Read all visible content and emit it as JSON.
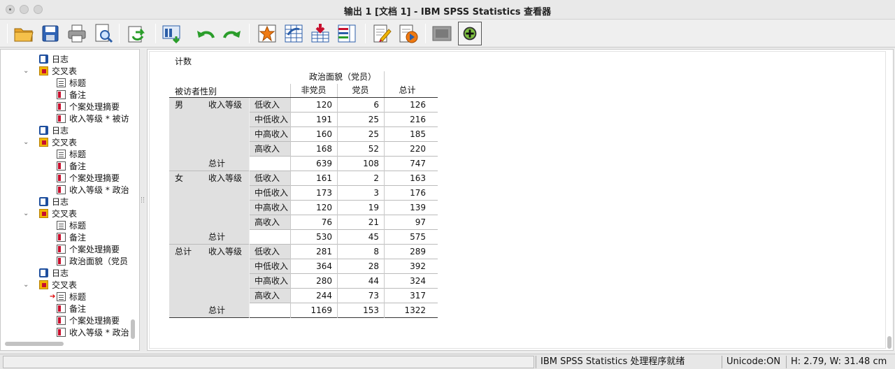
{
  "window": {
    "title": "输出 1 [文档 1] - IBM SPSS Statistics 查看器"
  },
  "toolbar": {
    "buttons": [
      "open-icon",
      "save-icon",
      "print-icon",
      "print-preview-icon",
      "export-icon",
      "recall-dialog-icon",
      "undo-icon",
      "redo-icon",
      "goto-data-icon",
      "goto-case-icon",
      "goto-variable-icon",
      "variables-icon",
      "designate-window-icon",
      "insert-output-icon",
      "hide-output-icon",
      "show-output-icon"
    ]
  },
  "nav": {
    "items": [
      {
        "label": "日志",
        "icon": "log-icon",
        "level": 1
      },
      {
        "label": "交叉表",
        "icon": "crosstab-icon",
        "level": 1
      },
      {
        "label": "标题",
        "icon": "title-icon",
        "level": 2
      },
      {
        "label": "备注",
        "icon": "notes-icon",
        "level": 2
      },
      {
        "label": "个案处理摘要",
        "icon": "table-icon",
        "level": 2
      },
      {
        "label": "收入等级 * 被访",
        "icon": "table-icon",
        "level": 2
      },
      {
        "label": "日志",
        "icon": "log-icon",
        "level": 1
      },
      {
        "label": "交叉表",
        "icon": "crosstab-icon",
        "level": 1
      },
      {
        "label": "标题",
        "icon": "title-icon",
        "level": 2
      },
      {
        "label": "备注",
        "icon": "notes-icon",
        "level": 2
      },
      {
        "label": "个案处理摘要",
        "icon": "table-icon",
        "level": 2
      },
      {
        "label": "收入等级 * 政治",
        "icon": "table-icon",
        "level": 2
      },
      {
        "label": "日志",
        "icon": "log-icon",
        "level": 1
      },
      {
        "label": "交叉表",
        "icon": "crosstab-icon",
        "level": 1
      },
      {
        "label": "标题",
        "icon": "title-icon",
        "level": 2
      },
      {
        "label": "备注",
        "icon": "notes-icon",
        "level": 2
      },
      {
        "label": "个案处理摘要",
        "icon": "table-icon",
        "level": 2
      },
      {
        "label": "政治面貌（党员",
        "icon": "table-icon",
        "level": 2
      },
      {
        "label": "日志",
        "icon": "log-icon",
        "level": 1
      },
      {
        "label": "交叉表",
        "icon": "crosstab-icon",
        "level": 1
      },
      {
        "label": "标题",
        "icon": "title-icon",
        "level": 2,
        "current": true
      },
      {
        "label": "备注",
        "icon": "notes-icon",
        "level": 2
      },
      {
        "label": "个案处理摘要",
        "icon": "table-icon",
        "level": 2
      },
      {
        "label": "收入等级 * 政治",
        "icon": "table-icon",
        "level": 2
      }
    ]
  },
  "pivot": {
    "caption": "计数",
    "col_group": "政治面貌（党员）",
    "row_var": "被访者性别",
    "col_headers": [
      "非党员",
      "党员",
      "总计"
    ],
    "groups": [
      {
        "label": "男",
        "var": "收入等级",
        "rows": [
          {
            "label": "低收入",
            "v": [
              "120",
              "6",
              "126"
            ]
          },
          {
            "label": "中低收入",
            "v": [
              "191",
              "25",
              "216"
            ]
          },
          {
            "label": "中高收入",
            "v": [
              "160",
              "25",
              "185"
            ]
          },
          {
            "label": "高收入",
            "v": [
              "168",
              "52",
              "220"
            ]
          }
        ],
        "total": {
          "label": "总计",
          "v": [
            "639",
            "108",
            "747"
          ]
        }
      },
      {
        "label": "女",
        "var": "收入等级",
        "rows": [
          {
            "label": "低收入",
            "v": [
              "161",
              "2",
              "163"
            ]
          },
          {
            "label": "中低收入",
            "v": [
              "173",
              "3",
              "176"
            ]
          },
          {
            "label": "中高收入",
            "v": [
              "120",
              "19",
              "139"
            ]
          },
          {
            "label": "高收入",
            "v": [
              "76",
              "21",
              "97"
            ]
          }
        ],
        "total": {
          "label": "总计",
          "v": [
            "530",
            "45",
            "575"
          ]
        }
      },
      {
        "label": "总计",
        "var": "收入等级",
        "rows": [
          {
            "label": "低收入",
            "v": [
              "281",
              "8",
              "289"
            ]
          },
          {
            "label": "中低收入",
            "v": [
              "364",
              "28",
              "392"
            ]
          },
          {
            "label": "中高收入",
            "v": [
              "280",
              "44",
              "324"
            ]
          },
          {
            "label": "高收入",
            "v": [
              "244",
              "73",
              "317"
            ]
          }
        ],
        "total": {
          "label": "总计",
          "v": [
            "1169",
            "153",
            "1322"
          ]
        }
      }
    ]
  },
  "status": {
    "message": "IBM SPSS Statistics 处理程序就绪",
    "unicode": "Unicode:ON",
    "dims": "H: 2.79, W: 31.48 cm"
  }
}
